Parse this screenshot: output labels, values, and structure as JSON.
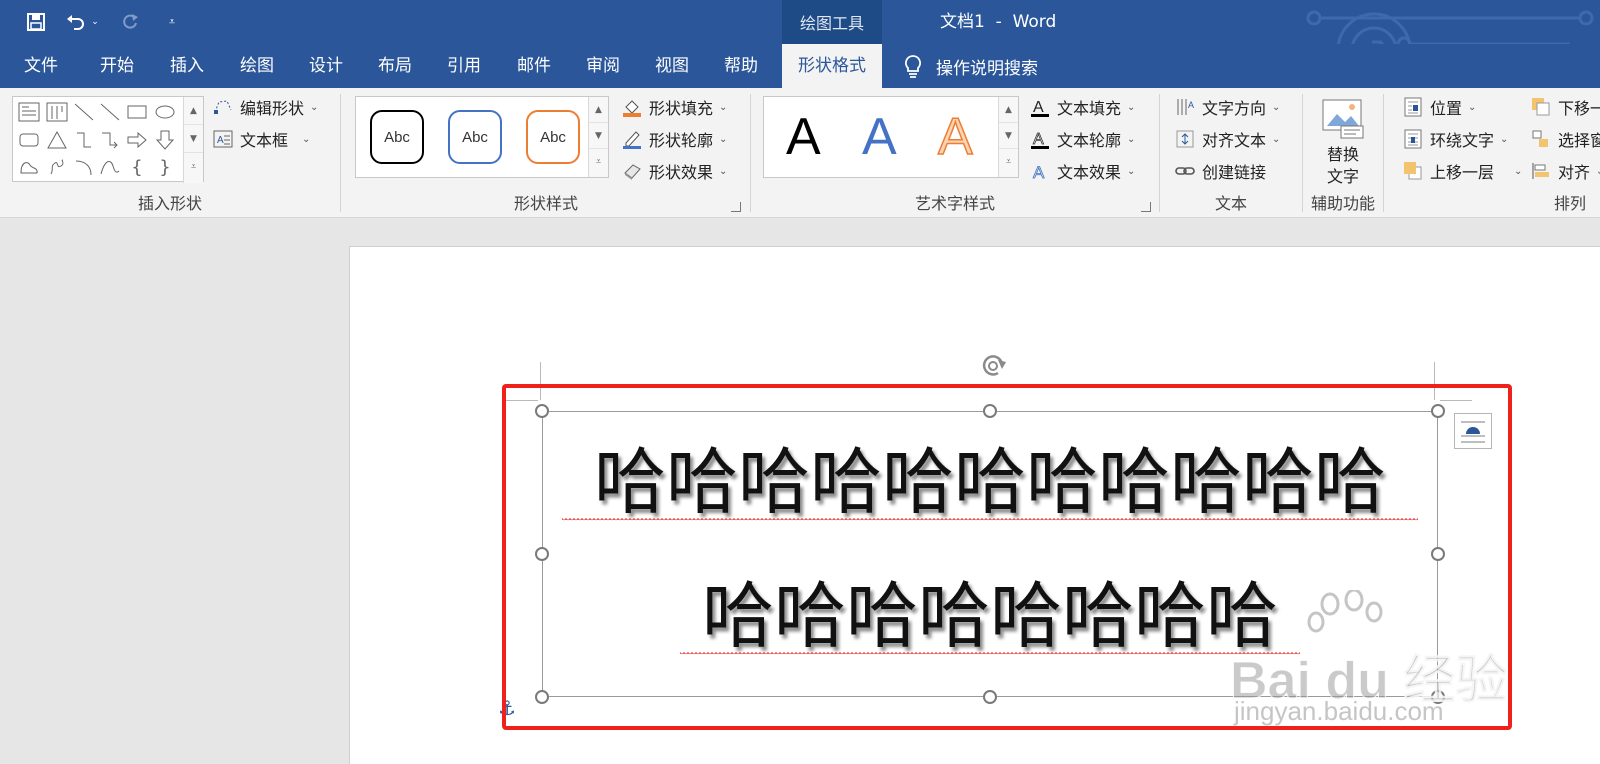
{
  "quick_access": {
    "save_icon": "save-icon",
    "undo_icon": "undo-icon",
    "redo_icon": "redo-icon",
    "customize_icon": "customize-qat-icon"
  },
  "title_bar": {
    "context_tab_group": "绘图工具",
    "document_title": "文档1  -  Word"
  },
  "tabs": [
    "文件",
    "开始",
    "插入",
    "绘图",
    "设计",
    "布局",
    "引用",
    "邮件",
    "审阅",
    "视图",
    "帮助",
    "形状格式"
  ],
  "active_tab": "形状格式",
  "tell_me": "操作说明搜索",
  "ribbon": {
    "insert_shapes": {
      "label": "插入形状",
      "edit_shape": "编辑形状",
      "text_box": "文本框"
    },
    "shape_styles": {
      "label": "形状样式",
      "presets": [
        "Abc",
        "Abc",
        "Abc"
      ],
      "preset_colors": [
        "#000000",
        "#4472c4",
        "#ed7d31"
      ],
      "shape_fill": "形状填充",
      "shape_outline": "形状轮廓",
      "shape_effects": "形状效果"
    },
    "wordart_styles": {
      "label": "艺术字样式",
      "presets": [
        "A",
        "A",
        "A"
      ],
      "text_fill": "文本填充",
      "text_outline": "文本轮廓",
      "text_effects": "文本效果"
    },
    "text": {
      "label": "文本",
      "text_direction": "文字方向",
      "align_text": "对齐文本",
      "create_link": "创建链接"
    },
    "accessibility": {
      "label": "辅助功能",
      "alt_text_line1": "替换",
      "alt_text_line2": "文字"
    },
    "arrange": {
      "label": "排列",
      "position": "位置",
      "wrap_text": "环绕文字",
      "bring_forward": "上移一层",
      "send_backward": "下移一",
      "selection_pane": "选择窗",
      "align": "对齐"
    }
  },
  "document": {
    "line1": "哈哈哈哈哈哈哈哈哈哈哈",
    "line2": "哈哈哈哈哈哈哈哈"
  },
  "watermark": {
    "brand": "Bai du 经验",
    "url": "jingyan.baidu.com"
  },
  "colors": {
    "title_blue": "#2b579a",
    "highlight_red": "#f0211b",
    "ribbon_bg": "#f3f3f3"
  }
}
